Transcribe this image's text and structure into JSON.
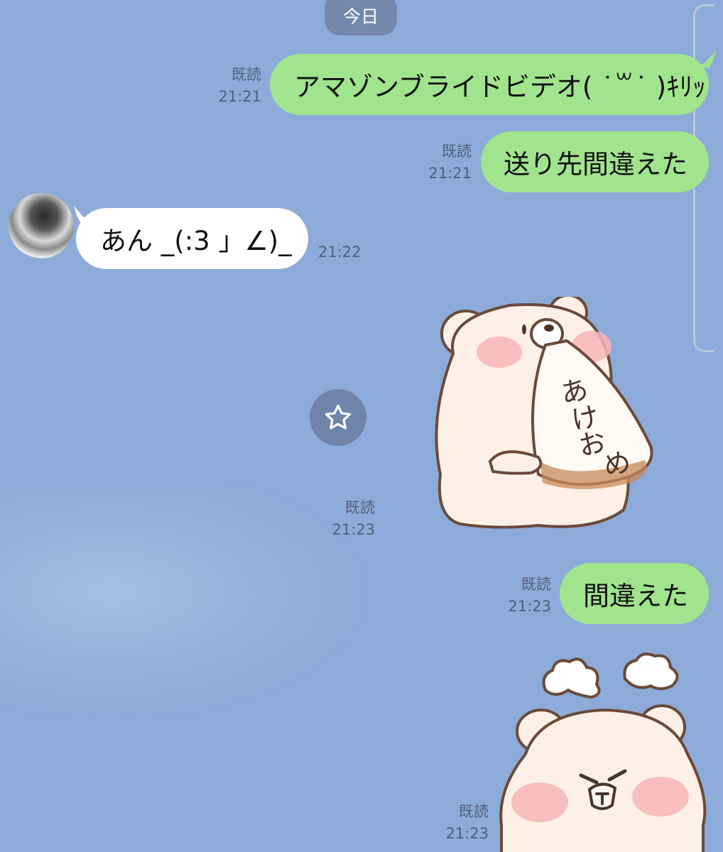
{
  "date_divider": "今日",
  "messages": [
    {
      "text": "アマゾンブライドビデオ( ˙꒳˙ )ｷﾘｯ",
      "read": "既読",
      "time": "21:21"
    },
    {
      "text": "送り先間違えた",
      "read": "既読",
      "time": "21:21"
    },
    {
      "text": "あん _(:3 」∠)_",
      "time": "21:22"
    },
    {
      "sticker": "bear-akeome-sticker",
      "sticker_text": "あけおめ",
      "read": "既読",
      "time": "21:23"
    },
    {
      "text": "間違えた",
      "read": "既読",
      "time": "21:23"
    },
    {
      "sticker": "bear-angry-sticker",
      "read": "既読",
      "time": "21:23"
    }
  ],
  "icons": {
    "star": "star-icon"
  },
  "colors": {
    "background": "#8dabd8",
    "my_bubble": "#a0e48e",
    "their_bubble": "#ffffff",
    "date_pill": "#7488ad"
  }
}
